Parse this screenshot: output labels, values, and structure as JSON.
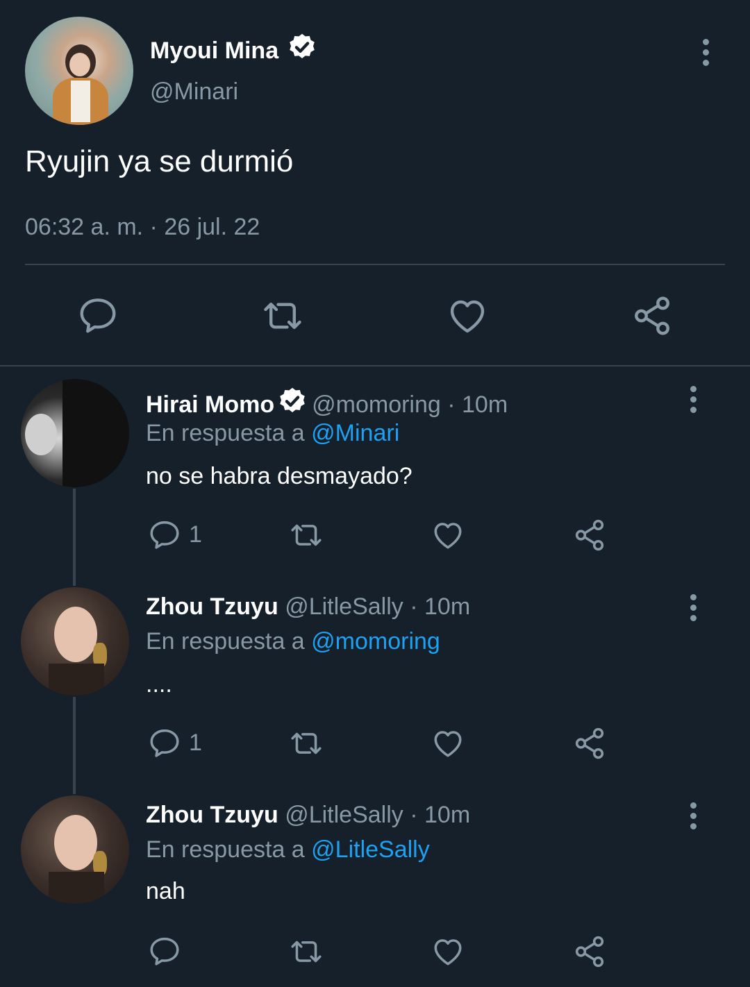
{
  "main_tweet": {
    "display_name": "Myoui Mina",
    "handle": "@Minari",
    "text": "Ryujin ya se durmió",
    "timestamp": "06:32 a. m. · 26 jul. 22"
  },
  "replies": [
    {
      "display_name": "Hirai Momo",
      "verified": true,
      "handle": "@momoring",
      "time": "· 10m",
      "reply_prefix": "En respuesta a",
      "reply_to": "@Minari",
      "text": "no se habra desmayado?",
      "reply_count": "1"
    },
    {
      "display_name": "Zhou Tzuyu",
      "verified": false,
      "handle": "@LitleSally",
      "time": "· 10m",
      "reply_prefix": "En respuesta a",
      "reply_to": "@momoring",
      "text": "....",
      "reply_count": "1"
    },
    {
      "display_name": "Zhou Tzuyu",
      "verified": false,
      "handle": "@LitleSally",
      "time": "· 10m",
      "reply_prefix": "En respuesta a",
      "reply_to": "@LitleSally",
      "text": "nah",
      "reply_count": ""
    }
  ],
  "colors": {
    "background": "#15202b",
    "muted": "#8899a6",
    "link": "#1da1f2",
    "divider": "#38444d"
  },
  "icons": [
    "verified-badge-icon",
    "more-options-icon",
    "reply-icon",
    "retweet-icon",
    "like-icon",
    "share-icon"
  ]
}
